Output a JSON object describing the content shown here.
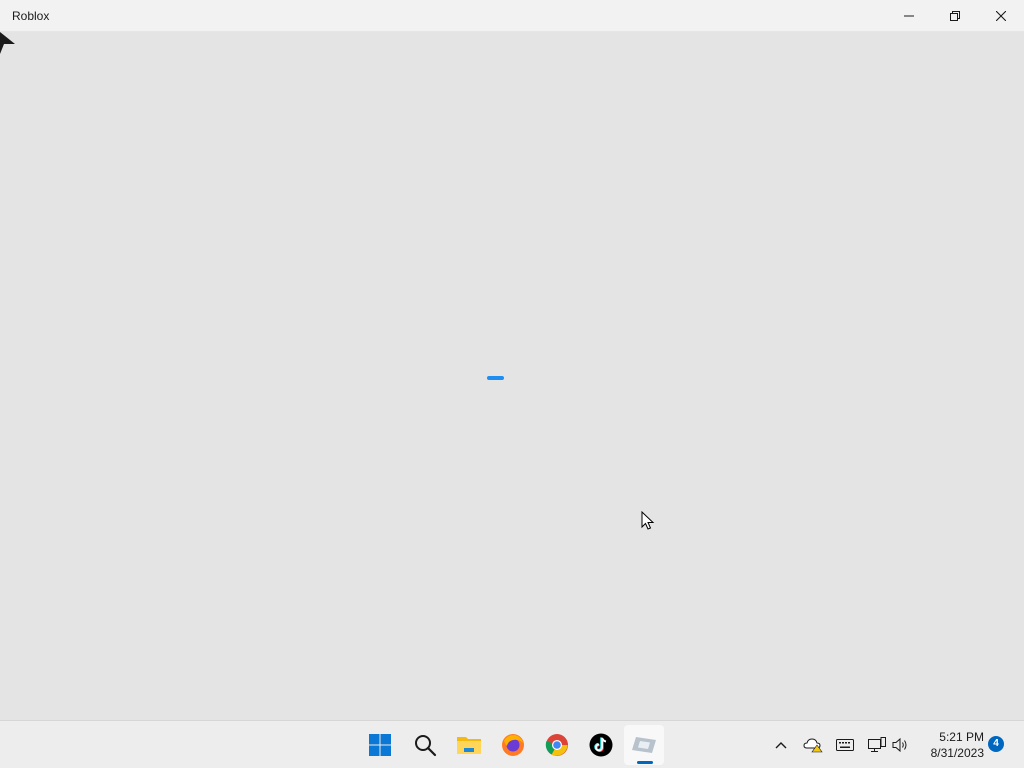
{
  "window": {
    "title": "Roblox"
  },
  "loading": {
    "accent": "#1f8ef1"
  },
  "taskbar": {
    "apps": [
      {
        "name": "Start",
        "icon": "windows-start-icon"
      },
      {
        "name": "Search",
        "icon": "search-icon"
      },
      {
        "name": "File Explorer",
        "icon": "folder-icon"
      },
      {
        "name": "Firefox",
        "icon": "firefox-icon"
      },
      {
        "name": "Chrome",
        "icon": "chrome-icon"
      },
      {
        "name": "TikTok",
        "icon": "tiktok-icon"
      },
      {
        "name": "Roblox",
        "icon": "roblox-icon",
        "active": true
      }
    ],
    "tray": {
      "icons": [
        "chevron-up-icon",
        "onedrive-warning-icon",
        "keyboard-icon",
        "network-icon",
        "volume-icon"
      ],
      "time": "5:21 PM",
      "date": "8/31/2023",
      "notification_count": "4"
    },
    "accent": "#0067c0"
  }
}
